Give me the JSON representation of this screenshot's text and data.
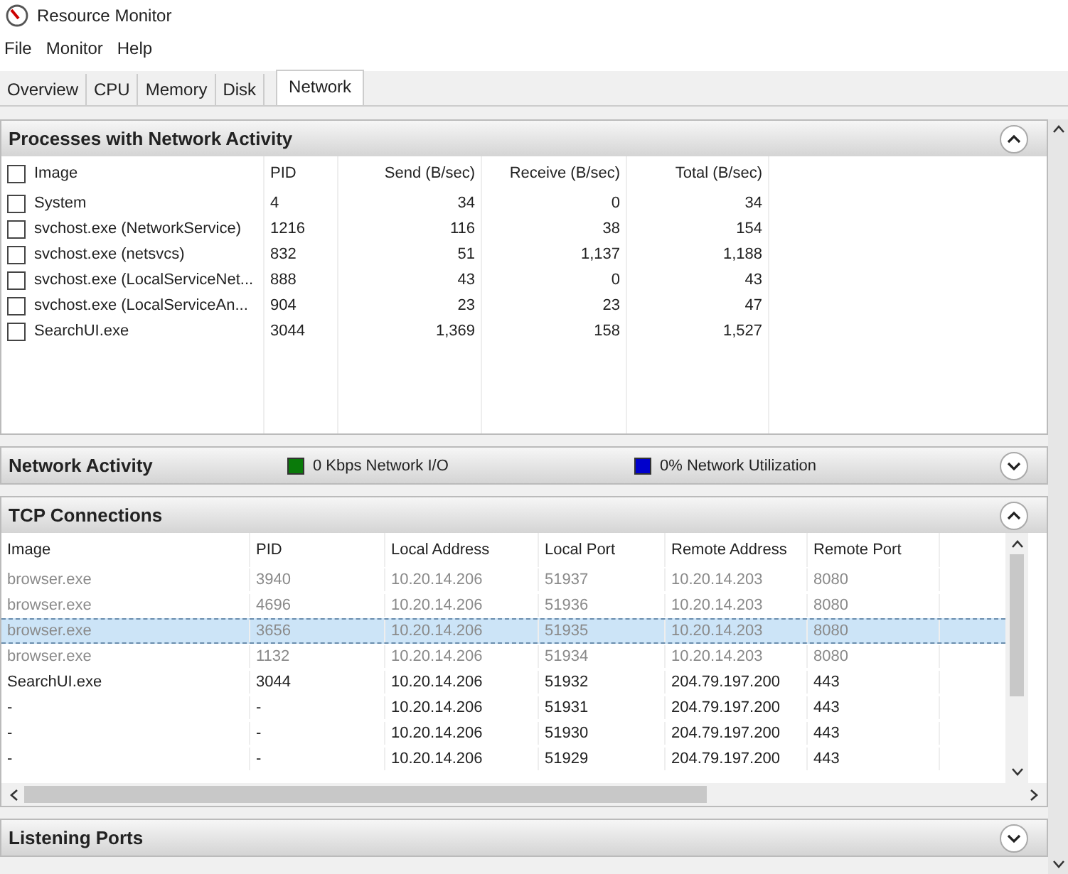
{
  "window": {
    "title": "Resource Monitor"
  },
  "menu": [
    "File",
    "Monitor",
    "Help"
  ],
  "tabs": [
    {
      "label": "Overview",
      "selected": false
    },
    {
      "label": "CPU",
      "selected": false
    },
    {
      "label": "Memory",
      "selected": false
    },
    {
      "label": "Disk",
      "selected": false
    },
    {
      "label": "Network",
      "selected": true
    }
  ],
  "processes": {
    "title": "Processes with Network Activity",
    "expanded": true,
    "all_checked": false,
    "columns": [
      "Image",
      "PID",
      "Send (B/sec)",
      "Receive (B/sec)",
      "Total (B/sec)"
    ],
    "rows": [
      {
        "checked": false,
        "cells": [
          "System",
          "4",
          "34",
          "0",
          "34"
        ]
      },
      {
        "checked": false,
        "cells": [
          "svchost.exe (NetworkService)",
          "1216",
          "116",
          "38",
          "154"
        ]
      },
      {
        "checked": false,
        "cells": [
          "svchost.exe (netsvcs)",
          "832",
          "51",
          "1,137",
          "1,188"
        ]
      },
      {
        "checked": false,
        "cells": [
          "svchost.exe (LocalServiceNet...",
          "888",
          "43",
          "0",
          "43"
        ]
      },
      {
        "checked": false,
        "cells": [
          "svchost.exe (LocalServiceAn...",
          "904",
          "23",
          "23",
          "47"
        ]
      },
      {
        "checked": false,
        "cells": [
          "SearchUI.exe",
          "3044",
          "1,369",
          "158",
          "1,527"
        ]
      }
    ]
  },
  "network_activity": {
    "title": "Network Activity",
    "expanded": false,
    "legend": [
      {
        "label": "0 Kbps Network I/O",
        "color": "#0a7a0a"
      },
      {
        "label": "0% Network Utilization",
        "color": "#0000cc"
      }
    ]
  },
  "tcp": {
    "title": "TCP Connections",
    "expanded": true,
    "columns": [
      "Image",
      "PID",
      "Local Address",
      "Local Port",
      "Remote Address",
      "Remote Port"
    ],
    "rows": [
      {
        "terminated": true,
        "selected": false,
        "cells": [
          "browser.exe",
          "3940",
          "10.20.14.206",
          "51937",
          "10.20.14.203",
          "8080"
        ]
      },
      {
        "terminated": true,
        "selected": false,
        "cells": [
          "browser.exe",
          "4696",
          "10.20.14.206",
          "51936",
          "10.20.14.203",
          "8080"
        ]
      },
      {
        "terminated": true,
        "selected": true,
        "cells": [
          "browser.exe",
          "3656",
          "10.20.14.206",
          "51935",
          "10.20.14.203",
          "8080"
        ]
      },
      {
        "terminated": true,
        "selected": false,
        "cells": [
          "browser.exe",
          "1132",
          "10.20.14.206",
          "51934",
          "10.20.14.203",
          "8080"
        ]
      },
      {
        "terminated": false,
        "selected": false,
        "cells": [
          "SearchUI.exe",
          "3044",
          "10.20.14.206",
          "51932",
          "204.79.197.200",
          "443"
        ]
      },
      {
        "terminated": false,
        "selected": false,
        "cells": [
          "-",
          "-",
          "10.20.14.206",
          "51931",
          "204.79.197.200",
          "443"
        ]
      },
      {
        "terminated": false,
        "selected": false,
        "cells": [
          "-",
          "-",
          "10.20.14.206",
          "51930",
          "204.79.197.200",
          "443"
        ]
      },
      {
        "terminated": false,
        "selected": false,
        "cells": [
          "-",
          "-",
          "10.20.14.206",
          "51929",
          "204.79.197.200",
          "443"
        ]
      }
    ]
  },
  "listening_ports": {
    "title": "Listening Ports",
    "expanded": false
  }
}
